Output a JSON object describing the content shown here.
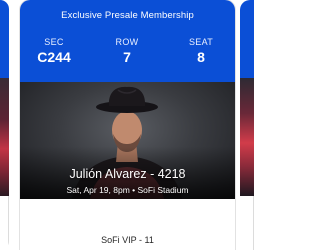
{
  "ticket": {
    "membership_label": "Exclusive Presale Membership",
    "sec_label": "SEC",
    "sec_value": "C244",
    "row_label": "ROW",
    "row_value": "7",
    "seat_label": "SEAT",
    "seat_value": "8",
    "event_title": "Julión Alvarez - 4218",
    "event_details": "Sat, Apr 19, 8pm • SoFi Stadium",
    "section_name": "SoFi VIP - 11"
  },
  "colors": {
    "header_blue": "#0b4fd6",
    "text_dark": "#262626"
  }
}
